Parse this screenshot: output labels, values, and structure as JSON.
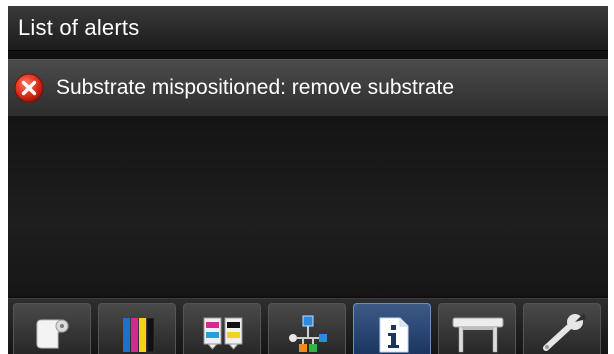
{
  "header": {
    "title": "List of alerts"
  },
  "alerts": [
    {
      "icon": "error-icon",
      "message": "Substrate mispositioned: remove substrate"
    }
  ],
  "toolbar": {
    "buttons": [
      {
        "name": "substrate",
        "icon": "substrate-roll-icon",
        "active": false
      },
      {
        "name": "ink-cartridges",
        "icon": "ink-cartridges-icon",
        "active": false
      },
      {
        "name": "printheads",
        "icon": "printheads-icon",
        "active": false
      },
      {
        "name": "network",
        "icon": "network-icon",
        "active": false
      },
      {
        "name": "information",
        "icon": "information-icon",
        "active": true
      },
      {
        "name": "printer",
        "icon": "printer-icon",
        "active": false
      },
      {
        "name": "settings",
        "icon": "wrench-icon",
        "active": false
      }
    ]
  },
  "colors": {
    "error": "#e0311f",
    "active_tab": "#2a4a7a",
    "ink": [
      "#1f6fd1",
      "#d42a8f",
      "#f2d21b",
      "#111111"
    ]
  }
}
